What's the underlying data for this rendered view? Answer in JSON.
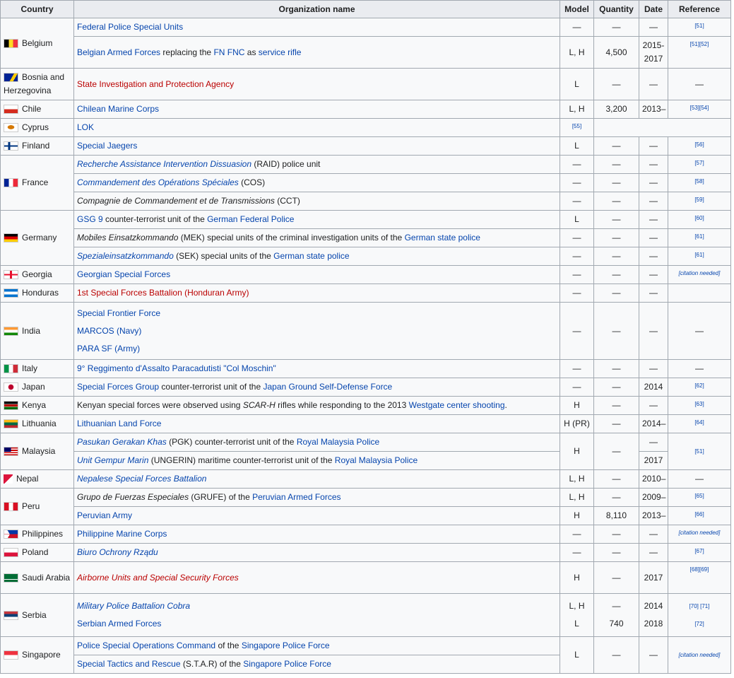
{
  "headers": {
    "country": "Country",
    "org": "Organization name",
    "model": "Model",
    "quantity": "Quantity",
    "date": "Date",
    "reference": "Reference"
  },
  "dash": "—",
  "rows": {
    "belgium": {
      "country": "Belgium",
      "r1": {
        "org": "Federal Police Special Units",
        "ref": "[51]"
      },
      "r2": {
        "org_a": "Belgian Armed Forces",
        "org_b": " replacing the ",
        "org_c": "FN FNC",
        "org_d": " as ",
        "org_e": "service rifle",
        "model": "L, H",
        "qty": "4,500",
        "date": "2015-\n2017",
        "ref": "[51][52]"
      }
    },
    "bosnia": {
      "country": "Bosnia and Herzegovina",
      "org": "State Investigation and Protection Agency",
      "model": "L"
    },
    "chile": {
      "country": "Chile",
      "org": "Chilean Marine Corps",
      "model": "L, H",
      "qty": "3,200",
      "date": "2013–",
      "ref": "[53][54]"
    },
    "cyprus": {
      "country": "Cyprus",
      "org": "LOK",
      "ref": "[55]"
    },
    "finland": {
      "country": "Finland",
      "org": "Special Jaegers",
      "model": "L",
      "ref": "[56]"
    },
    "france": {
      "country": "France",
      "r1": {
        "org_a": "Recherche Assistance Intervention Dissuasion",
        "org_b": " (RAID) police unit",
        "ref": "[57]"
      },
      "r2": {
        "org_a": "Commandement des Opérations Spéciales",
        "org_b": " (COS)",
        "ref": "[58]"
      },
      "r3": {
        "org_a": "Compagnie de Commandement et de Transmissions",
        "org_b": " (CCT)",
        "ref": "[59]"
      }
    },
    "germany": {
      "country": "Germany",
      "r1": {
        "org_a": "GSG 9",
        "org_b": " counter-terrorist unit of the ",
        "org_c": "German Federal Police",
        "model": "L",
        "ref": "[60]"
      },
      "r2": {
        "org_a": "Mobiles Einsatzkommando",
        "org_b": " (MEK) special units of the criminal investigation units of the ",
        "org_c": "German state police",
        "ref": "[61]"
      },
      "r3": {
        "org_a": "Spezialeinsatzkommando",
        "org_b": " (SEK) special units of the ",
        "org_c": "German state police",
        "ref": "[61]"
      }
    },
    "georgia": {
      "country": "Georgia",
      "org": "Georgian Special Forces",
      "ref": "[citation needed]"
    },
    "honduras": {
      "country": "Honduras",
      "org": "1st Special Forces Battalion (Honduran Army)"
    },
    "india": {
      "country": "India",
      "org1": "Special Frontier Force",
      "org2": "MARCOS (Navy)",
      "org3": "PARA SF (Army)"
    },
    "italy": {
      "country": "Italy",
      "org": "9° Reggimento d'Assalto Paracadutisti \"Col Moschin\""
    },
    "japan": {
      "country": "Japan",
      "org_a": "Special Forces Group",
      "org_b": " counter-terrorist unit of the ",
      "org_c": "Japan Ground Self-Defense Force",
      "date": "2014",
      "ref": "[62]"
    },
    "kenya": {
      "country": "Kenya",
      "org_a": "Kenyan",
      "org_b": " special forces were observed using ",
      "org_c": "SCAR-H",
      "org_d": " rifles while responding to the 2013 ",
      "org_e": "Westgate center shooting",
      "org_f": ".",
      "model": "H",
      "ref": "[63]"
    },
    "lithuania": {
      "country": "Lithuania",
      "org": "Lithuanian Land Force",
      "model": "H (PR)",
      "date": "2014–",
      "ref": "[64]"
    },
    "malaysia": {
      "country": "Malaysia",
      "r1": {
        "org_a": "Pasukan Gerakan Khas",
        "org_b": " (PGK) counter-terrorist unit of the ",
        "org_c": "Royal Malaysia Police"
      },
      "r2": {
        "org_a": "Unit Gempur Marin",
        "org_b": " (UNGERIN) maritime counter-terrorist unit of the ",
        "org_c": "Royal Malaysia Police",
        "date": "2017"
      },
      "model": "H",
      "ref": "[51]"
    },
    "nepal": {
      "country": "Nepal",
      "org": "Nepalese Special Forces Battalion",
      "model": "L, H",
      "date": "2010–"
    },
    "peru": {
      "country": "Peru",
      "r1": {
        "org_a": "Grupo de Fuerzas Especiales",
        "org_b": " (GRUFE) of the ",
        "org_c": "Peruvian Armed Forces",
        "model": "L, H",
        "date": "2009–",
        "ref": "[65]"
      },
      "r2": {
        "org": "Peruvian Army",
        "model": "H",
        "qty": "8,110",
        "date": "2013–",
        "ref": "[66]"
      }
    },
    "philippines": {
      "country": "Philippines",
      "org": "Philippine Marine Corps",
      "ref": "[citation needed]"
    },
    "poland": {
      "country": "Poland",
      "org": "Biuro Ochrony Rządu",
      "ref": "[67]"
    },
    "saudi": {
      "country": "Saudi Arabia",
      "org": "Airborne Units and Special Security Forces",
      "model": "H",
      "date": "2017",
      "ref": "[68][69]"
    },
    "serbia": {
      "country": "Serbia",
      "org1": "Military Police Battalion Cobra",
      "org2": "Serbian Armed Forces",
      "model1": "L, H",
      "model2": "L",
      "qty2": "740",
      "date1": "2014",
      "date2": "2018",
      "ref1": "[70] [71]",
      "ref2": "[72]"
    },
    "singapore": {
      "country": "Singapore",
      "r1": {
        "org_a": "Police Special Operations Command",
        "org_b": " of the ",
        "org_c": "Singapore Police Force"
      },
      "r2": {
        "org_a": "Special Tactics and Rescue",
        "org_b": " (S.T.A.R) of the ",
        "org_c": "Singapore Police Force"
      },
      "model": "L",
      "ref": "[citation needed]"
    }
  },
  "colors": {
    "link": "#0645ad",
    "redlink": "#ba0000",
    "header_bg": "#eaecf0",
    "cell_bg": "#f8f9fa",
    "border": "#a2a9b1"
  }
}
